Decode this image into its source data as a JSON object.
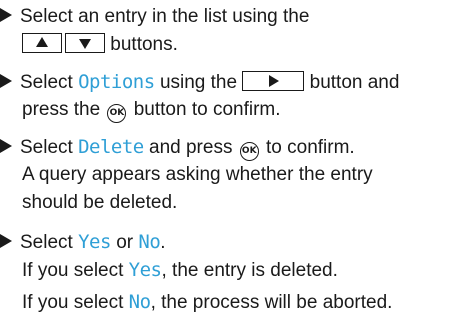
{
  "step1": {
    "line1": "Select an entry in the list using the",
    "line2_after": "buttons.",
    "btn_up_icon": "up-arrow-icon",
    "btn_down_icon": "down-arrow-icon"
  },
  "step2": {
    "line1_before": "Select ",
    "keyword": "Options",
    "line1_mid": " using the ",
    "line1_after": " button and",
    "line2_before": "press the ",
    "ok_label": "OK",
    "line2_after": " button to confirm.",
    "btn_right_icon": "right-arrow-icon"
  },
  "step3": {
    "line1_before": "Select ",
    "keyword": "Delete",
    "line1_mid": " and press ",
    "ok_label": "OK",
    "line1_after": " to confirm.",
    "line2": "A query appears asking whether the entry",
    "line3": "should be deleted."
  },
  "step4": {
    "line1_before": "Select ",
    "yes": "Yes",
    "or": " or ",
    "no": "No",
    "period": ".",
    "line2_before": "If you select ",
    "line2_yes": "Yes",
    "line2_after": ", the entry is deleted.",
    "line3_before": "If you select ",
    "line3_no": "No",
    "line3_after": ", the process will be aborted."
  },
  "colors": {
    "keyword": "#2f9fd6",
    "text": "#1a1a1a"
  }
}
